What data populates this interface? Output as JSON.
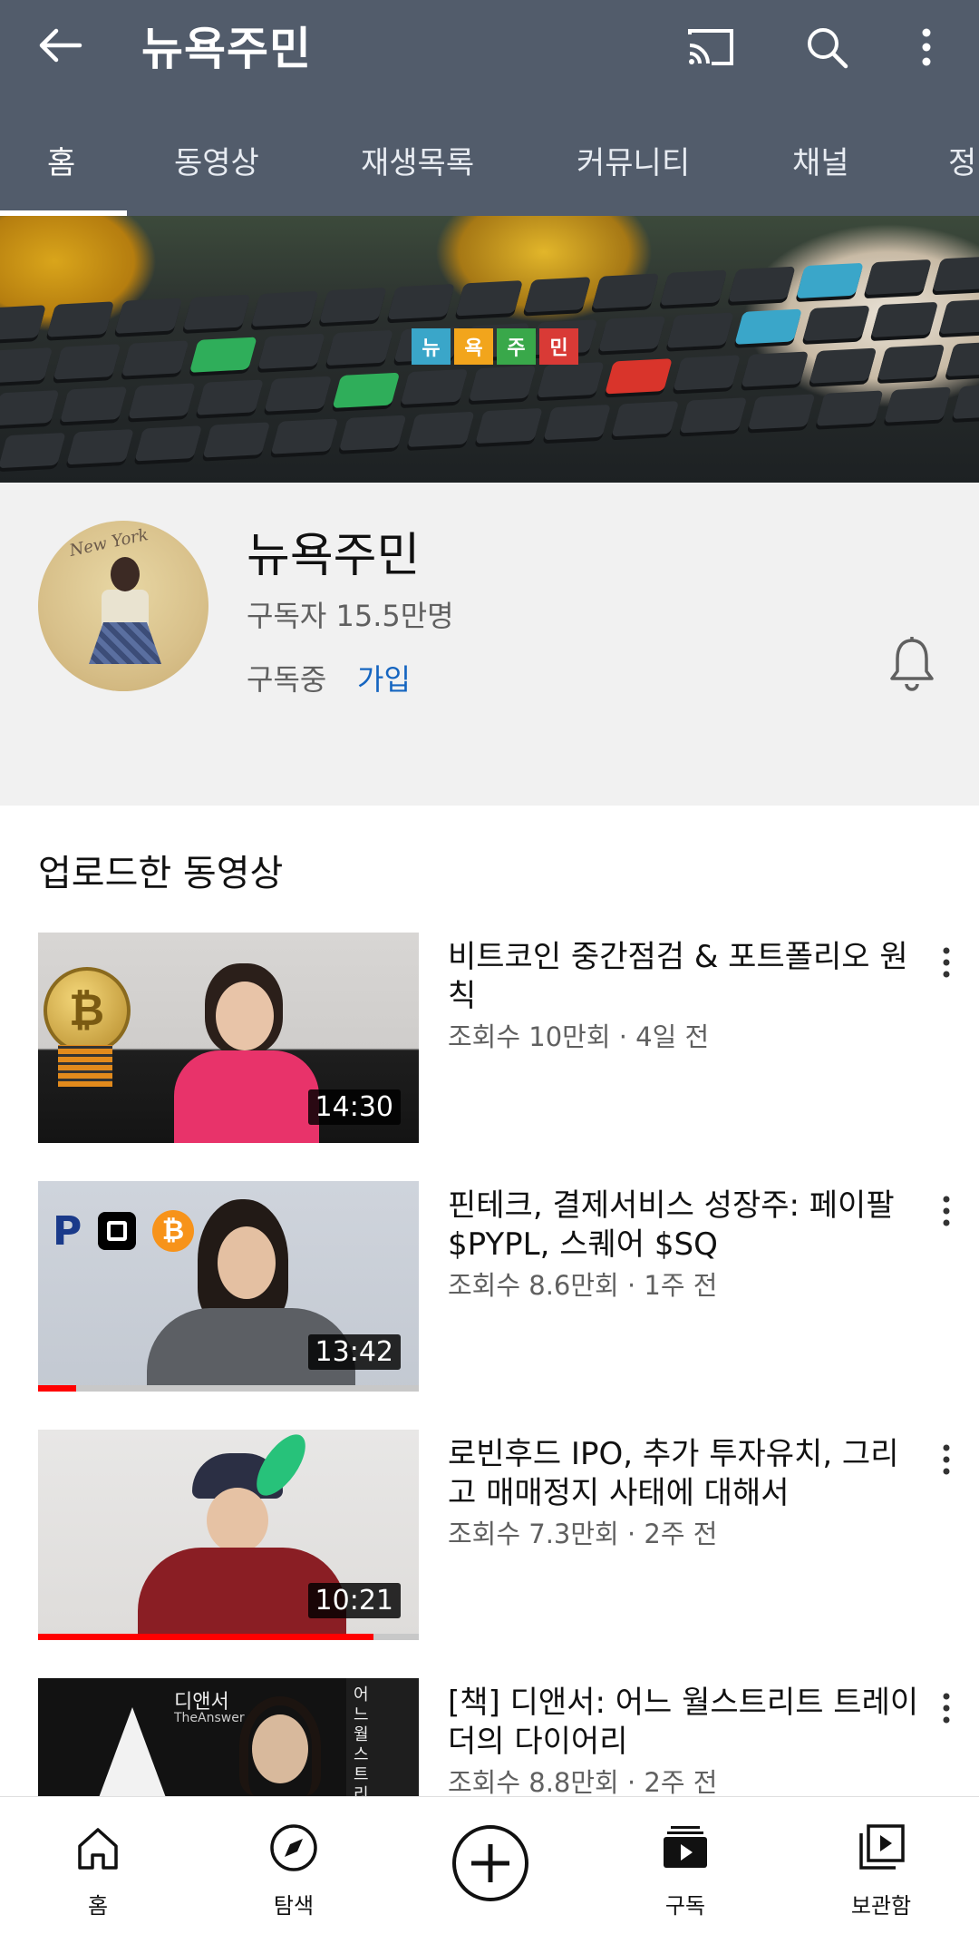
{
  "header": {
    "title": "뉴욕주민",
    "icons": [
      "back-arrow-icon",
      "cast-icon",
      "search-icon",
      "more-vert-icon"
    ]
  },
  "tabs": [
    {
      "label": "홈",
      "active": true
    },
    {
      "label": "동영상",
      "active": false
    },
    {
      "label": "재생목록",
      "active": false
    },
    {
      "label": "커뮤니티",
      "active": false
    },
    {
      "label": "채널",
      "active": false
    },
    {
      "label": "정",
      "active": false
    }
  ],
  "banner": {
    "logo_tiles": [
      {
        "text": "뉴",
        "color": "#3aa6c9"
      },
      {
        "text": "욕",
        "color": "#f2a51c"
      },
      {
        "text": "주",
        "color": "#39a84a"
      },
      {
        "text": "민",
        "color": "#d93a36"
      }
    ]
  },
  "channel": {
    "name": "뉴욕주민",
    "subscribers": "구독자 15.5만명",
    "status": "구독중",
    "join": "가입",
    "avatar_text": "New York"
  },
  "section": {
    "title": "업로드한 동영상"
  },
  "videos": [
    {
      "title": "비트코인 중간점검 & 포트폴리오 원칙",
      "meta": "조회수 10만회 · 4일 전",
      "duration": "14:30",
      "watched": 0
    },
    {
      "title": "핀테크, 결제서비스 성장주: 페이팔 $PYPL, 스퀘어 $SQ",
      "meta": "조회수 8.6만회 · 1주 전",
      "duration": "13:42",
      "watched": 0.1
    },
    {
      "title": "로빈후드 IPO, 추가 투자유치, 그리고 매매정지 사태에 대해서",
      "meta": "조회수 7.3만회 · 2주 전",
      "duration": "10:21",
      "watched": 0.88
    },
    {
      "title": "[책] 디앤서: 어느 월스트리트 트레이더의 다이어리",
      "meta": "조회수 8.8만회 · 2주 전",
      "duration": "",
      "watched": 0,
      "thumb_title": "디앤서",
      "thumb_subtitle": "TheAnswer",
      "thumb_vertical": "어느 월스트리트 트레이더의 다이어리"
    }
  ],
  "bottom_nav": [
    {
      "label": "홈",
      "icon": "home-icon"
    },
    {
      "label": "탐색",
      "icon": "explore-icon"
    },
    {
      "label": "",
      "icon": "add-icon"
    },
    {
      "label": "구독",
      "icon": "subscriptions-icon"
    },
    {
      "label": "보관함",
      "icon": "library-icon"
    }
  ]
}
